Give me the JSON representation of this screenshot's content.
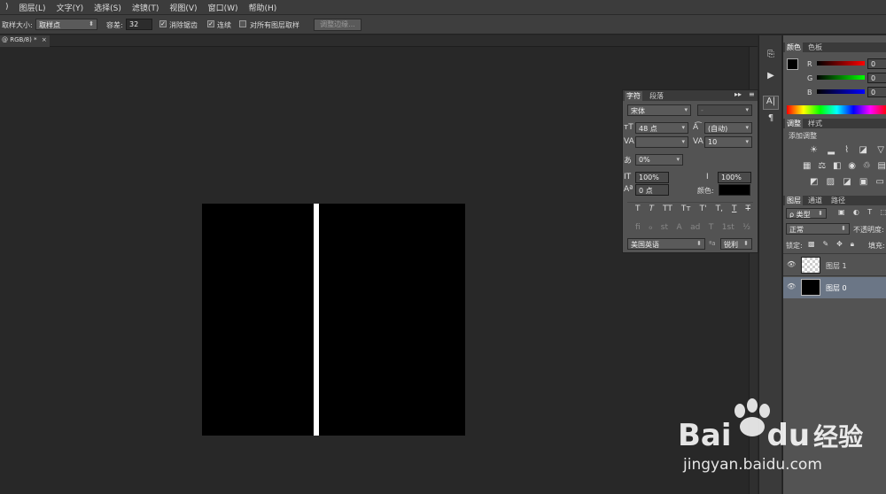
{
  "menu": [
    ")",
    "图层(L)",
    "文字(Y)",
    "选择(S)",
    "滤镜(T)",
    "视图(V)",
    "窗口(W)",
    "帮助(H)"
  ],
  "options": {
    "sample_size_label": "取样大小:",
    "sample_size_value": "取样点",
    "tolerance_label": "容差:",
    "tolerance_value": "32",
    "antialias_label": "消除锯齿",
    "contiguous_label": "连续",
    "all_layers_label": "对所有图层取样",
    "refine_edge_button": "调整边缘..."
  },
  "document_tab": {
    "title": "@ RGB/8) *",
    "close": "×"
  },
  "side_dock_icons": [
    "history-icon",
    "actions-icon",
    "character-icon",
    "paragraph-icon"
  ],
  "character_panel": {
    "tabs": [
      "字符",
      "段落"
    ],
    "font_family": "宋体",
    "font_style": "-",
    "font_size": "48 点",
    "leading": "(自动)",
    "kerning": "",
    "tracking": "10",
    "scale_percent": "0%",
    "vertical_scale": "100%",
    "horizontal_scale": "100%",
    "baseline_shift": "0 点",
    "color_label": "颜色:",
    "color_value": "#000000",
    "style_buttons": [
      "T",
      "T",
      "TT",
      "Tт",
      "T'",
      "T,",
      "T",
      "T"
    ],
    "opentype_buttons": [
      "fi",
      "ℴ",
      "st",
      "A",
      "ad",
      "T",
      "1st",
      "½"
    ],
    "language": "美国英语",
    "aa_label": "a",
    "antialias": "锐利"
  },
  "color_panel": {
    "tabs": [
      "颜色",
      "色板"
    ],
    "channels": [
      {
        "label": "R",
        "value": "0"
      },
      {
        "label": "G",
        "value": "0"
      },
      {
        "label": "B",
        "value": "0"
      }
    ]
  },
  "adjustments_panel": {
    "tabs": [
      "调整",
      "样式"
    ],
    "title": "添加调整"
  },
  "layers_panel": {
    "tabs": [
      "图层",
      "通道",
      "路径"
    ],
    "filter_kind": "ρ 类型",
    "blend_mode": "正常",
    "opacity_label": "不透明度:",
    "lock_label": "锁定:",
    "fill_label": "填充:",
    "layers": [
      {
        "name": "图层 1",
        "selected": false
      },
      {
        "name": "图层 0",
        "selected": true
      }
    ]
  },
  "watermark": {
    "brand": "Bai",
    "brand2": "du",
    "suffix": "经验",
    "url": "jingyan.baidu.com"
  }
}
